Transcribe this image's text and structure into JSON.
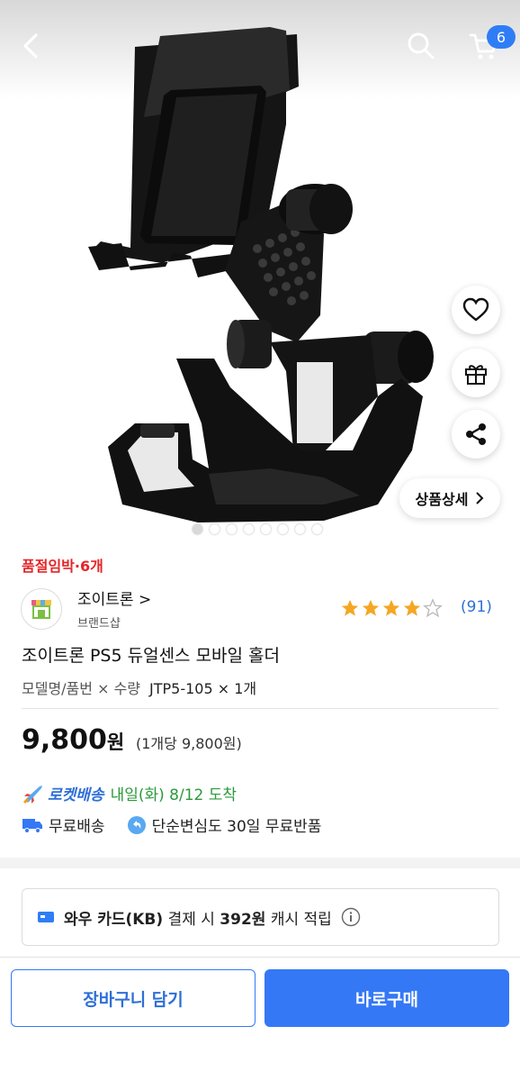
{
  "header": {
    "cart_count": "6"
  },
  "colors": {
    "accent": "#3478f6",
    "rocket_green": "#2b9a3a",
    "alert_red": "#e52528",
    "star": "#f5a623"
  },
  "icons": [
    "back-arrow-icon",
    "search-icon",
    "cart-icon",
    "heart-icon",
    "gift-icon",
    "share-icon",
    "chevron-right-icon",
    "truck-icon",
    "return-icon",
    "card-icon",
    "info-icon",
    "rocket-icon",
    "store-icon"
  ],
  "detail_button": "상품상세",
  "gallery": {
    "total": 8,
    "active": 1
  },
  "stock_notice": "품절임박·6개",
  "store": {
    "name": "조이트론",
    "type": "브랜드샵"
  },
  "rating": {
    "stars": 4,
    "count": "(91)"
  },
  "product": {
    "title": "조이트론 PS5 듀얼센스 모바일 홀더",
    "option_label": "모델명/품번 × 수량",
    "option_value": "JTP5-105 × 1개"
  },
  "price": {
    "amount": "9,800",
    "currency": "원",
    "unit_price": "(1개당 9,800원)"
  },
  "delivery": {
    "rocket_brand": "로켓배송",
    "eta": "내일(화) 8/12 도착",
    "free_shipping": "무료배송",
    "return_policy": "단순변심도 30일 무료반품"
  },
  "card_offer": {
    "card": "와우 카드(KB)",
    "text_a": "결제 시",
    "amount": "392원",
    "text_b": "캐시 적립"
  },
  "actions": {
    "add_to_cart": "장바구니 담기",
    "buy_now": "바로구매"
  }
}
